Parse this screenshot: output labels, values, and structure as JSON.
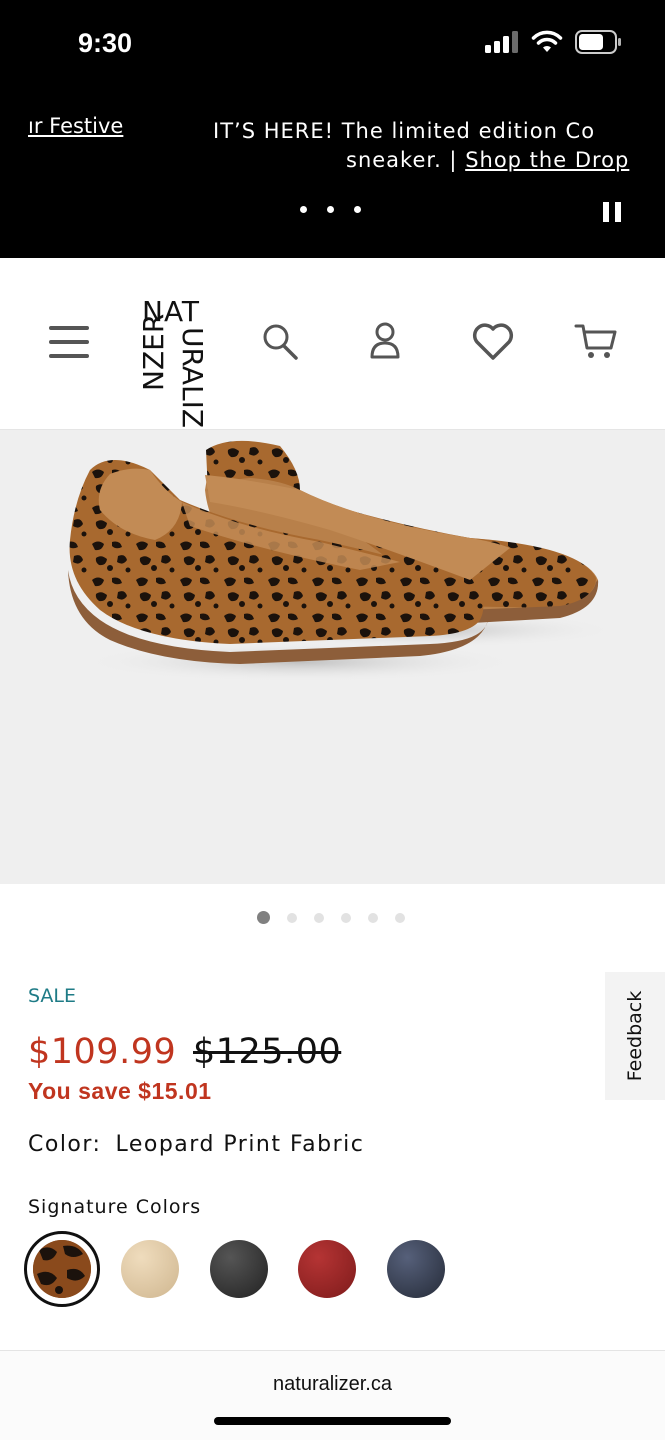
{
  "status_bar": {
    "time": "9:30",
    "icons": [
      "signal-icon",
      "wifi-icon",
      "battery-icon"
    ]
  },
  "promo_banner": {
    "left_partial_text": "ır Festive",
    "line1": "IT’S HERE! The limited edition Co",
    "line2_prefix": "sneaker. | ",
    "line2_link": "Shop the Drop",
    "dots_count": 3,
    "pause_icon": "pause-icon"
  },
  "header": {
    "menu_icon": "hamburger-menu-icon",
    "logo": {
      "top": "NAT",
      "left_col": "NZER",
      "right_col": "URALIZ"
    },
    "search_icon": "search-icon",
    "account_icon": "user-icon",
    "wishlist_icon": "heart-icon",
    "cart_icon": "cart-icon"
  },
  "product": {
    "image_alt": "Leopard print ballet flats",
    "sale_label": "SALE",
    "price_current": "$109.99",
    "price_original": "$125.00",
    "savings": "You save $15.01",
    "color_label": "Color:",
    "color_value": "Leopard Print Fabric",
    "signature_colors_label": "Signature Colors",
    "swatches": [
      {
        "name": "leopard",
        "color": "#8a4a1c",
        "selected": true
      },
      {
        "name": "beige",
        "color": "#dcc6a3"
      },
      {
        "name": "black",
        "color": "#3a3a3a"
      },
      {
        "name": "red",
        "color": "#9c2424"
      },
      {
        "name": "navy",
        "color": "#3a4253"
      }
    ]
  },
  "carousel": {
    "total": 6,
    "active_index": 0
  },
  "feedback": {
    "label": "Feedback"
  },
  "browser": {
    "url": "naturalizer.ca"
  },
  "colors": {
    "sale_teal": "#1e7b86",
    "price_red": "#c0351f",
    "banner_bg": "#000000",
    "hero_bg": "#efefef"
  }
}
